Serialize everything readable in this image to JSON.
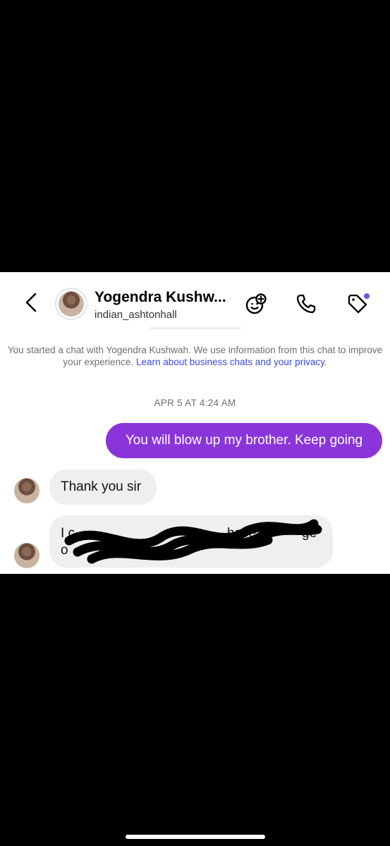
{
  "header": {
    "title": "Yogendra Kushw...",
    "username": "indian_ashtonhall"
  },
  "icons": {
    "back": "chevron-left-icon",
    "effects": "sticker-plus-icon",
    "call": "phone-icon",
    "label": "tag-icon"
  },
  "chat": {
    "info_prefix": "You started a chat with Yogendra Kushwah. We use information from this chat to improve your experience. ",
    "info_link": "Learn about business chats and your privacy",
    "info_suffix": ".",
    "timestamp": "APR 5 AT 4:24 AM",
    "messages": [
      {
        "direction": "outgoing",
        "text": "You will blow up my brother. Keep going"
      },
      {
        "direction": "incoming",
        "text": "Thank you sir"
      },
      {
        "direction": "incoming",
        "text_line1": "I c",
        "text_line2": "o",
        "text_fragment_have": "have m",
        "text_fragment_ge": "ge",
        "text_fragment_ch": "ch",
        "redacted": true
      }
    ]
  },
  "colors": {
    "outgoing_bubble": "#8a35d9",
    "incoming_bubble": "#efeff2",
    "link": "#3a4ad8",
    "notification_dot": "#5b5cf6"
  }
}
